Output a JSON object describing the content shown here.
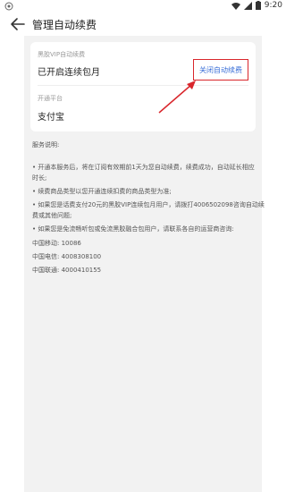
{
  "status_bar": {
    "time": "9:20"
  },
  "header": {
    "title": "管理自动续费"
  },
  "card": {
    "service_label": "黑胶VIP自动续费",
    "service_value": "已开启连续包月",
    "close_button": "关闭自动续费",
    "platform_label": "开通平台",
    "platform_value": "支付宝"
  },
  "notes": {
    "title": "服务说明:",
    "item1_line1": "• 开通本服务后，将在订阅有效期前1天为您自动续费，续费成功，自动延长相应",
    "item1_line2": "时长;",
    "item2": "• 续费商品类型以您开通连续扣费的商品类型为准;",
    "item3_line1": "• 如果您是话费支付20元的黑胶VIP连续包月用户，请拨打4006502098咨询自动续",
    "item3_line2": "费或其他问题;",
    "item4": "• 如果您是免流畅听包或免流黑胶融合包用户，请联系各自的运营商咨询:",
    "carriers": [
      {
        "name": "中国移动",
        "number": "10086"
      },
      {
        "name": "中国电信",
        "number": "4008308100"
      },
      {
        "name": "中国联通",
        "number": "4000410155"
      }
    ]
  },
  "colors": {
    "accent_link": "#3a6fd8",
    "highlight_red": "#d9262c"
  }
}
